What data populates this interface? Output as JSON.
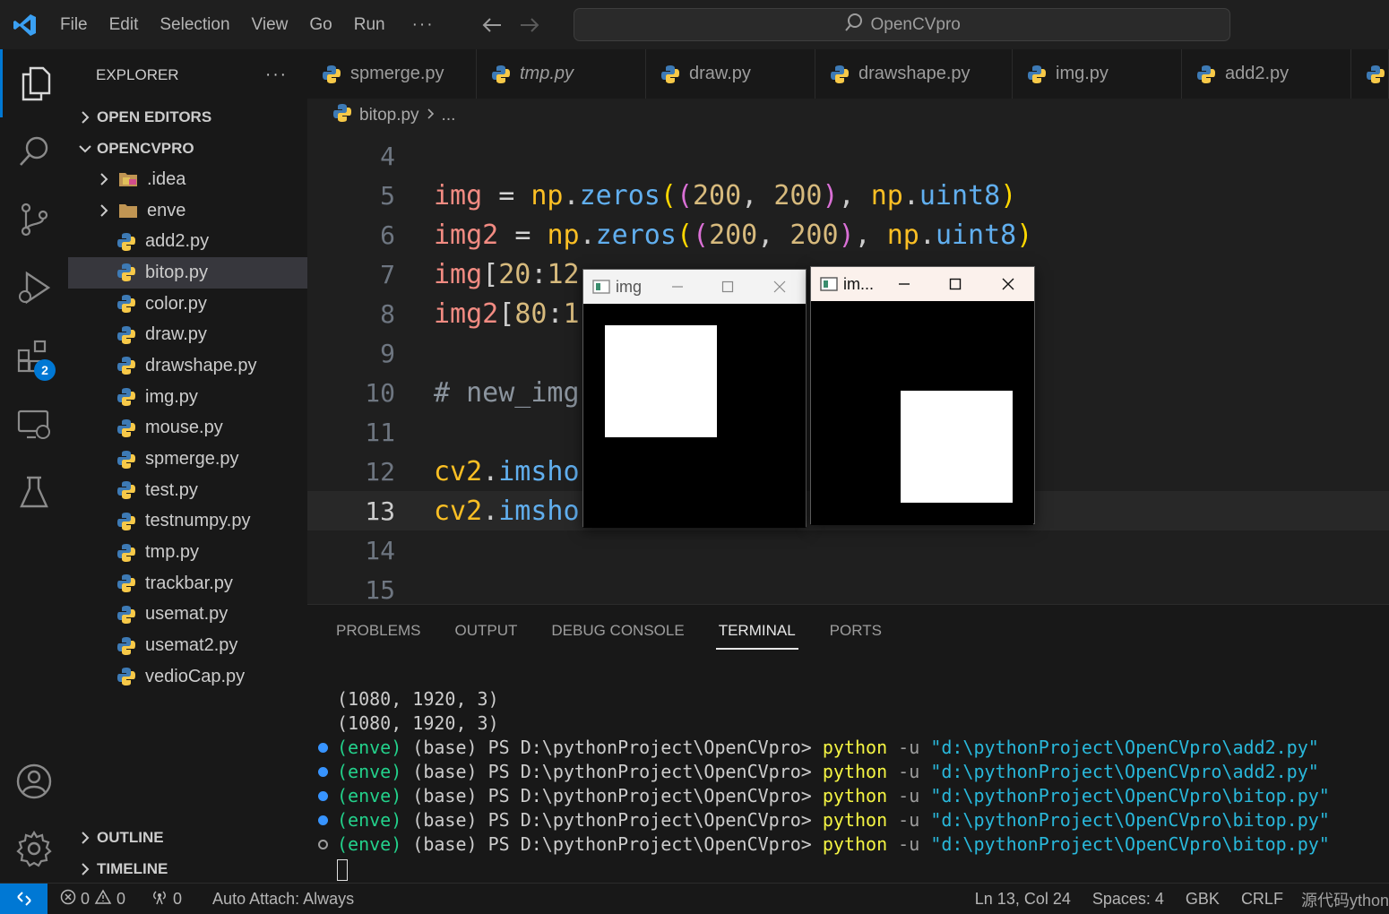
{
  "menu": {
    "items": [
      "File",
      "Edit",
      "Selection",
      "View",
      "Go",
      "Run"
    ],
    "more": "···"
  },
  "search": {
    "placeholder": "OpenCVpro"
  },
  "activity": {
    "extensions_badge": "2"
  },
  "explorer": {
    "title": "EXPLORER",
    "more": "···",
    "open_editors": "OPEN EDITORS",
    "project": "OPENCVPRO",
    "folders": [
      ".idea",
      "enve"
    ],
    "files": [
      "add2.py",
      "bitop.py",
      "color.py",
      "draw.py",
      "drawshape.py",
      "img.py",
      "mouse.py",
      "spmerge.py",
      "test.py",
      "testnumpy.py",
      "tmp.py",
      "trackbar.py",
      "usemat.py",
      "usemat2.py",
      "vedioCap.py"
    ],
    "selected": "bitop.py",
    "outline": "OUTLINE",
    "timeline": "TIMELINE"
  },
  "tabs": [
    "spmerge.py",
    "tmp.py",
    "draw.py",
    "drawshape.py",
    "img.py",
    "add2.py"
  ],
  "breadcrumb": {
    "file": "bitop.py",
    "rest": "..."
  },
  "editor": {
    "line_numbers": [
      "4",
      "5",
      "6",
      "7",
      "8",
      "9",
      "10",
      "11",
      "12",
      "13",
      "14",
      "15"
    ],
    "current_line": "13"
  },
  "panel": {
    "tabs": [
      "PROBLEMS",
      "OUTPUT",
      "DEBUG CONSOLE",
      "TERMINAL",
      "PORTS"
    ],
    "active": "TERMINAL",
    "output_lines": [
      "(1080, 1920, 3)",
      "(1080, 1920, 3)"
    ],
    "prompt_env": "(enve)",
    "prompt_base": "(base) PS D:\\pythonProject\\OpenCVpro>",
    "cmd": "python",
    "flag": "-u",
    "runs": [
      "\"d:\\pythonProject\\OpenCVpro\\add2.py\"",
      "\"d:\\pythonProject\\OpenCVpro\\add2.py\"",
      "\"d:\\pythonProject\\OpenCVpro\\bitop.py\"",
      "\"d:\\pythonProject\\OpenCVpro\\bitop.py\"",
      "\"d:\\pythonProject\\OpenCVpro\\bitop.py\""
    ]
  },
  "cv_windows": [
    {
      "title": "img"
    },
    {
      "title": "im..."
    }
  ],
  "status": {
    "errors": "0",
    "warnings": "0",
    "ports": "0",
    "auto_attach": "Auto Attach: Always",
    "position": "Ln 13, Col 24",
    "spaces": "Spaces: 4",
    "encoding": "GBK",
    "eol": "CRLF",
    "watermark": "源代码ython"
  },
  "colors": {
    "accent": "#0078d4",
    "editor_bg": "#1f1f1f",
    "sidebar_bg": "#181818"
  }
}
